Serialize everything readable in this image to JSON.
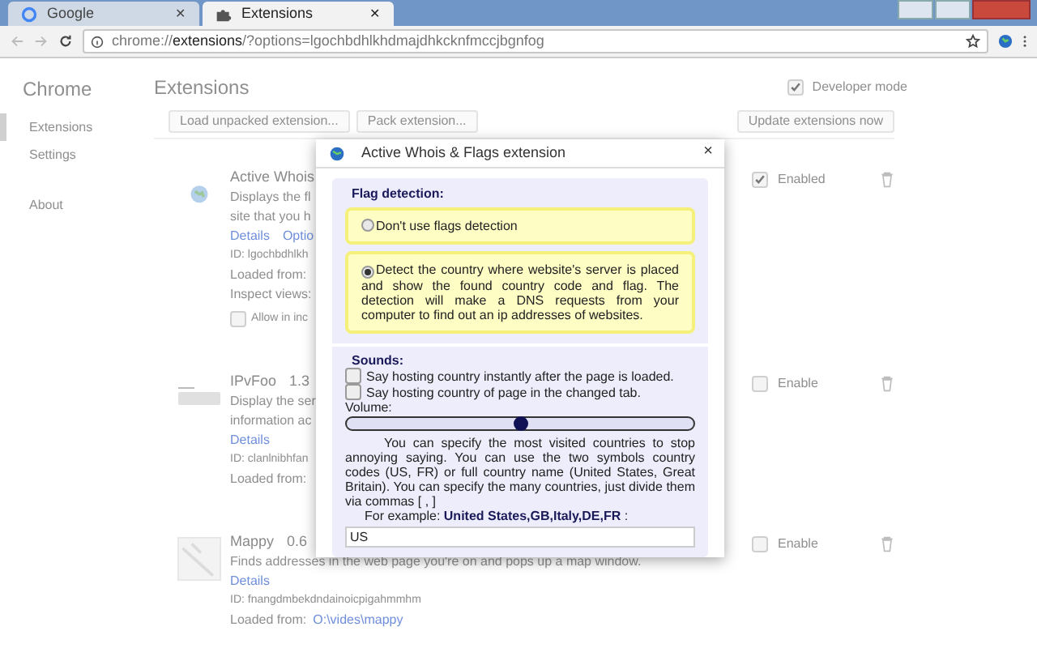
{
  "browser": {
    "tabs": [
      {
        "title": "Google",
        "kind": "google",
        "close": "✕",
        "selected": false
      },
      {
        "title": "Extensions",
        "kind": "puzzle",
        "close": "✕",
        "selected": true
      }
    ],
    "url": "chrome://**extensions**/?options=lgochbdhlkhdmajdhkcknfmccjbgnfog"
  },
  "sidebar": {
    "title": "Chrome",
    "items": [
      {
        "label": "Extensions",
        "selected": true
      },
      {
        "label": "Settings",
        "selected": false
      },
      {
        "label": "About",
        "selected": false
      }
    ]
  },
  "page": {
    "title": "Extensions",
    "developer_mode": {
      "label": "Developer mode",
      "checked": true
    },
    "buttons": [
      "Load unpacked extension...",
      "Pack extension..."
    ],
    "update_button": "Update extensions now"
  },
  "extensions": [
    {
      "name": "Active Whois",
      "description": [
        "Displays the fl",
        "site that you h"
      ],
      "links": [
        "Details",
        "Optio"
      ],
      "id": "ID: lgochbdhlkh",
      "loaded_from_label": "Loaded from:",
      "inspect_views": "Inspect views:",
      "incognito": {
        "label": "Allow in inc",
        "checked": false
      },
      "enable": {
        "label": "Enabled",
        "checked": true
      }
    },
    {
      "name": "IPvFoo",
      "version": "1.3",
      "description": [
        "Display the ser",
        "information ac"
      ],
      "links": [
        "Details"
      ],
      "id": "ID: clanlnibhfan",
      "loaded_from_label": "Loaded from:",
      "enable": {
        "label": "Enable",
        "checked": false
      }
    },
    {
      "name": "Mappy",
      "version": "0.6",
      "description": [
        "Finds addresses in the web page you're on and pops up a map window."
      ],
      "links": [
        "Details"
      ],
      "id": "ID: fnangdmbekdndainoicpigahmmhm",
      "loaded_from_label": "Loaded from:",
      "loaded_from": "O:\\vides\\mappy",
      "enable": {
        "label": "Enable",
        "checked": false
      }
    }
  ],
  "dialog": {
    "title": "Active Whois & Flags extension",
    "close": "×",
    "flag_detection": {
      "heading": "Flag detection:",
      "options": [
        {
          "label": "Don't use flags detection",
          "selected": false
        },
        {
          "label": "Detect the country where website's server is placed and show the found country code and flag. The detection will make a DNS requests from your computer to find out an ip addresses of websites.",
          "selected": true
        }
      ]
    },
    "sounds": {
      "heading": "Sounds:",
      "options": [
        {
          "label": "Say hosting country instantly after the page is loaded.",
          "checked": false
        },
        {
          "label": "Say hosting country of page in the changed tab.",
          "checked": false
        }
      ],
      "volume_label": "Volume:",
      "volume": {
        "level": 0.5
      },
      "note": "You can specify the most visited countries to stop annoying saying. You can use the two symbols country codes (US, FR) or full country name (United States, Great Britain). You can specify the many countries, just divide them via commas [ , ]",
      "example": "For example: **United States,GB,Italy,DE,FR** :",
      "countries": "US"
    }
  }
}
